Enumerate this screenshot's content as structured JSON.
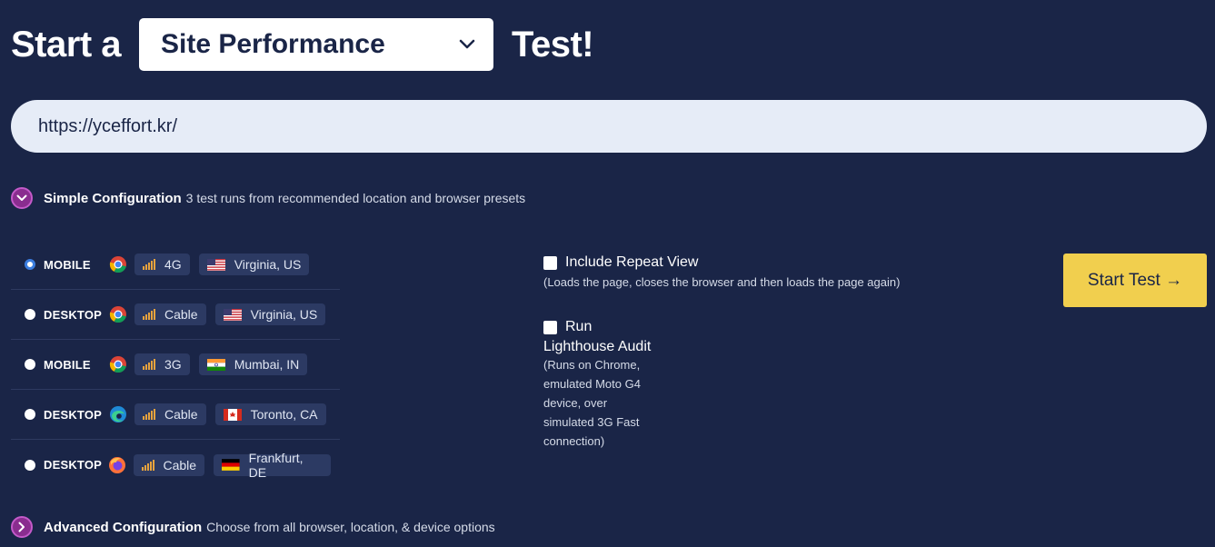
{
  "header": {
    "prefix": "Start a",
    "test_type": "Site Performance",
    "suffix": "Test!"
  },
  "url_input": {
    "value": "https://yceffort.kr/"
  },
  "simple_config": {
    "title": "Simple Configuration",
    "description": "3 test runs from recommended location and browser presets"
  },
  "presets": [
    {
      "device": "MOBILE",
      "browser": "chrome-icon",
      "connection": "4G",
      "location": "Virginia, US",
      "flag": "us-flag-icon",
      "selected": true
    },
    {
      "device": "DESKTOP",
      "browser": "chrome-icon",
      "connection": "Cable",
      "location": "Virginia, US",
      "flag": "us-flag-icon",
      "selected": false
    },
    {
      "device": "MOBILE",
      "browser": "chrome-icon",
      "connection": "3G",
      "location": "Mumbai, IN",
      "flag": "india-flag-icon",
      "selected": false
    },
    {
      "device": "DESKTOP",
      "browser": "edge-icon",
      "connection": "Cable",
      "location": "Toronto, CA",
      "flag": "canada-flag-icon",
      "selected": false
    },
    {
      "device": "DESKTOP",
      "browser": "firefox-icon",
      "connection": "Cable",
      "location": "Frankfurt, DE",
      "flag": "germany-flag-icon",
      "selected": false
    }
  ],
  "options": {
    "repeat_view": {
      "label": "Include Repeat View",
      "note": "(Loads the page, closes the browser and then loads the page again)"
    },
    "lighthouse": {
      "label_line1": "Run",
      "label_line2": "Lighthouse Audit",
      "note_lines": [
        "(Runs on Chrome,",
        "emulated Moto G4",
        "device, over",
        "simulated 3G Fast",
        "connection)"
      ]
    }
  },
  "start_button": {
    "label": "Start Test →"
  },
  "advanced_config": {
    "title": "Advanced Configuration",
    "description": "Choose from all browser, location, & device options"
  },
  "colors": {
    "background": "#1a2547",
    "accent_yellow": "#f1cf4e",
    "toggle_purple": "#8a2d8f",
    "url_bar": "#e6ecf7"
  }
}
